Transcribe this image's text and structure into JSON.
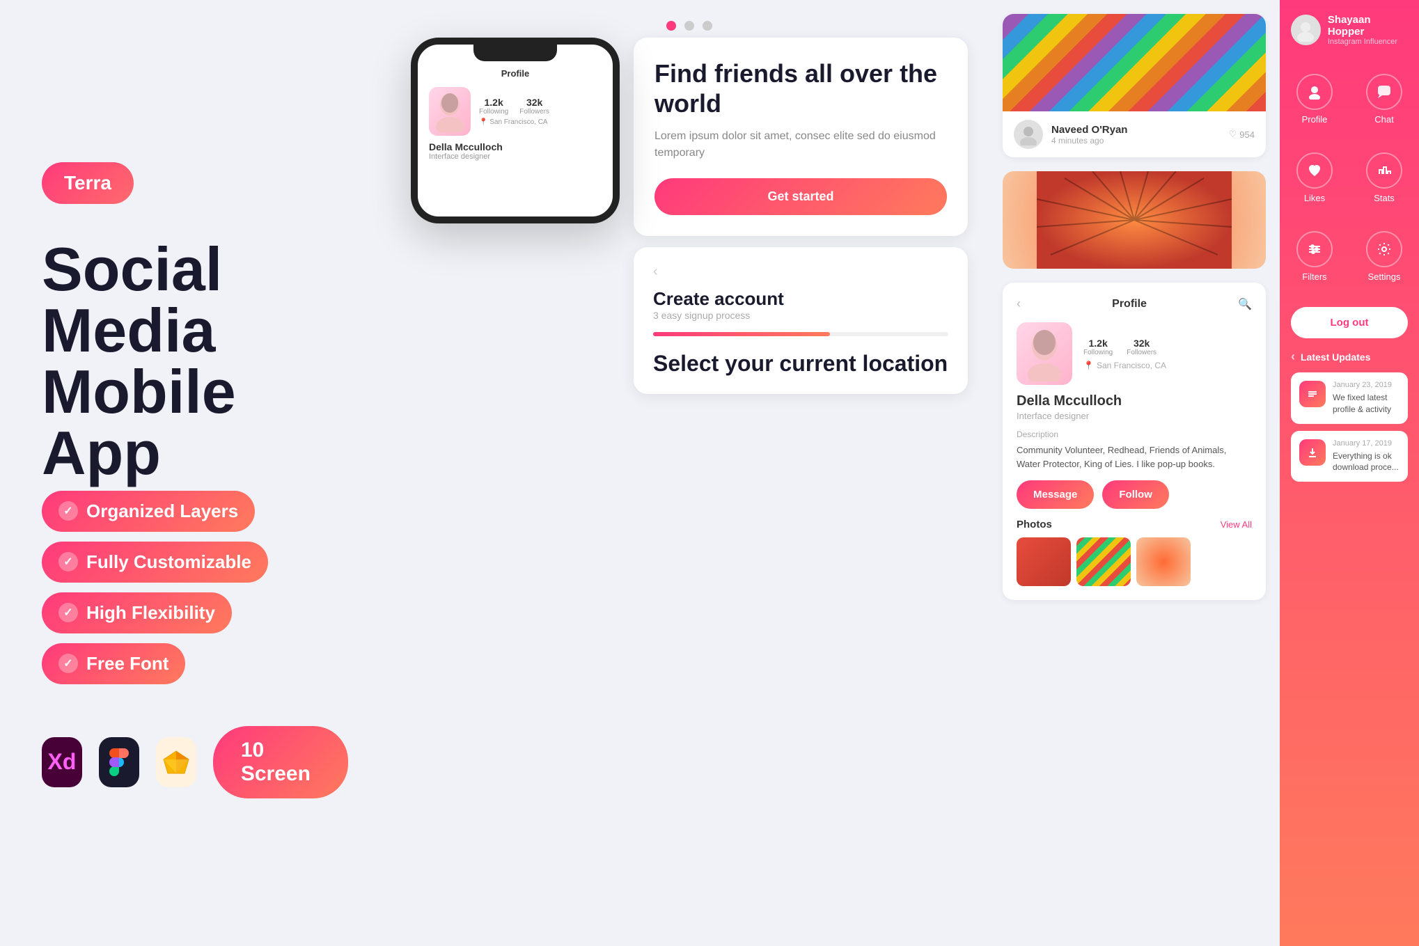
{
  "brand": {
    "name": "Terra"
  },
  "hero": {
    "title_line1": "Social Media",
    "title_line2": "Mobile App"
  },
  "features": [
    {
      "label": "Organized Layers"
    },
    {
      "label": "Fully Customizable"
    },
    {
      "label": "High Flexibility"
    },
    {
      "label": "Free Font"
    }
  ],
  "tools": [
    {
      "name": "xd-icon",
      "label": "Xd"
    },
    {
      "name": "figma-icon",
      "label": "Fig"
    },
    {
      "name": "sketch-icon",
      "label": "Sk"
    }
  ],
  "screen_count": "10 Screen",
  "phone_screen": {
    "header": "Profile",
    "stats": [
      {
        "value": "1.2k",
        "label": "Following"
      },
      {
        "value": "32k",
        "label": "Followers"
      }
    ],
    "location": "San Francisco, CA",
    "name": "Della Mcculloch",
    "role": "Interface designer"
  },
  "info_card": {
    "title": "Find friends all over the world",
    "description": "Lorem ipsum dolor sit amet, consec elite sed do eiusmod temporary",
    "cta": "Get started"
  },
  "create_account": {
    "title": "Create account",
    "subtitle": "3 easy signup process",
    "location_title": "Select your current location"
  },
  "post": {
    "author": "Naveed O'Ryan",
    "time": "4 minutes ago",
    "likes": "954"
  },
  "profile_detail": {
    "header": "Profile",
    "stats": [
      {
        "value": "1.2k",
        "label": "Following"
      },
      {
        "value": "32k",
        "label": "Followers"
      }
    ],
    "location": "San Francisco, CA",
    "name": "Della Mcculloch",
    "role": "Interface designer",
    "description_label": "Description",
    "description": "Community Volunteer, Redhead, Friends of Animals, Water Protector, King of Lies. I like pop-up books.",
    "message_btn": "Message",
    "follow_btn": "Follow",
    "photos_label": "Photos",
    "view_all": "View All"
  },
  "sidebar": {
    "user_name": "Shayaan Hopper",
    "user_subtitle": "Instagram Influencer",
    "nav_items": [
      {
        "icon": "👤",
        "label": "Profile"
      },
      {
        "icon": "✉",
        "label": "Chat"
      },
      {
        "icon": "♡",
        "label": "Likes"
      },
      {
        "icon": "🛒",
        "label": "Stats"
      },
      {
        "icon": "⚙",
        "label": "Filters"
      },
      {
        "icon": "⚙",
        "label": "Settings"
      }
    ],
    "logout": "Log out",
    "updates_title": "Latest Updates",
    "updates": [
      {
        "date": "January 23, 2019",
        "text": "We fixed latest profile & activity"
      },
      {
        "date": "January 17, 2019",
        "text": "Everything is ok download proce..."
      }
    ]
  },
  "dots": {
    "active_index": 0,
    "count": 3
  }
}
